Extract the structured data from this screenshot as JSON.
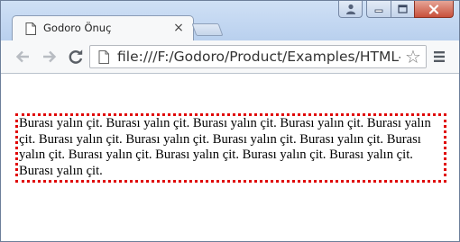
{
  "tab": {
    "title": "Godoro Önuç",
    "close_glyph": "×",
    "icon": "document-icon"
  },
  "window_controls": {
    "user_icon": "user-icon",
    "minimize_icon": "minimize-icon",
    "maximize_icon": "maximize-icon",
    "close_icon": "close-icon"
  },
  "toolbar": {
    "back_icon": "back-arrow-icon",
    "forward_icon": "forward-arrow-icon",
    "reload_icon": "reload-icon",
    "url": "file:///F:/Godoro/Product/Examples/HTML-CSS",
    "star_glyph": "☆",
    "menu_icon": "hamburger-menu-icon"
  },
  "content": {
    "paragraph": "Burası yalın çit. Burası yalın çit. Burası yalın çit. Burası yalın çit. Burası yalın çit. Burası yalın çit. Burası yalın çit. Burası yalın çit. Burası yalın çit. Burası yalın çit. Burası yalın çit. Burası yalın çit. Burası yalın çit. Burası yalın çit. Burası yalın çit.",
    "border_color": "#e00000",
    "border_style": "dotted"
  },
  "colors": {
    "frame": "#bdd3ee",
    "close_button": "#c8503b"
  }
}
